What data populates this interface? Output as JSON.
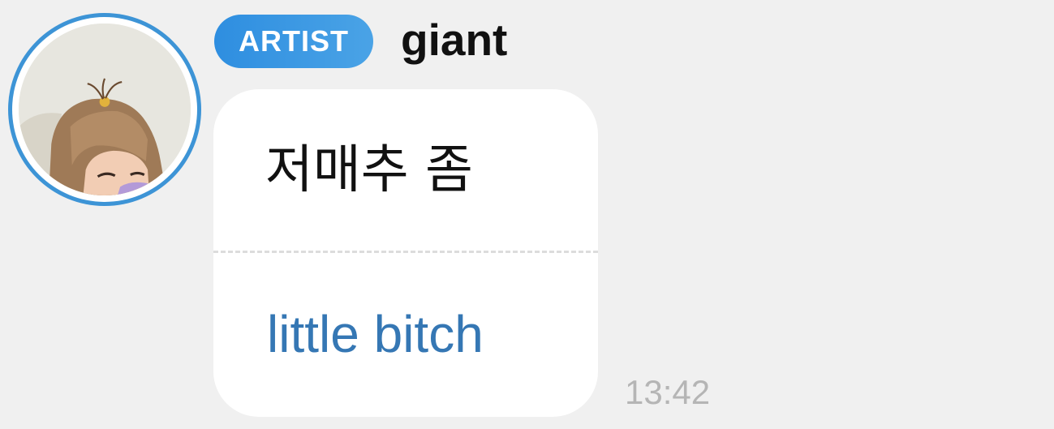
{
  "sender": {
    "badge": "ARTIST",
    "name": "giant",
    "avatar": "profile-photo"
  },
  "message": {
    "original_text": "저매추 좀",
    "translated_text": "little bitch",
    "time": "13:42"
  },
  "colors": {
    "background": "#f0f0f0",
    "badge": "#3d94d6",
    "translation_text": "#3577b4",
    "timestamp": "#b5b5b5"
  }
}
